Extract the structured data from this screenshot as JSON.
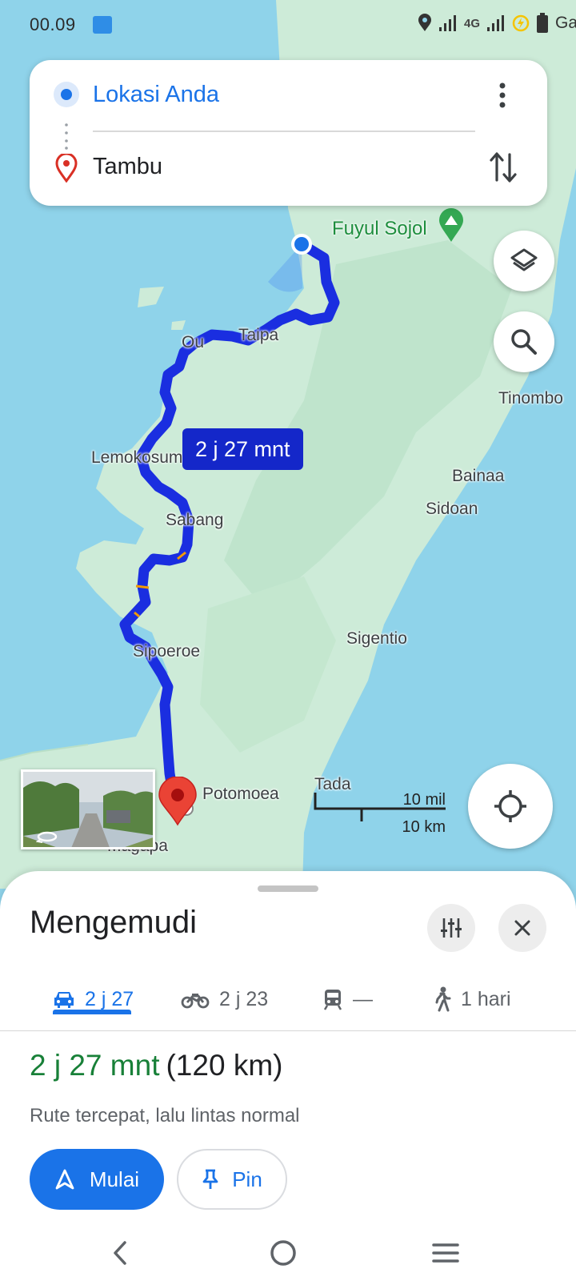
{
  "status_bar": {
    "time": "00.09",
    "network": "4G",
    "carrier": "Ga"
  },
  "directions": {
    "origin": "Lokasi Anda",
    "destination": "Tambu"
  },
  "map": {
    "poi": "Fuyul Sojol",
    "duration_callout": "2 j 27 mnt",
    "places": {
      "taipa": "Taipa",
      "ou": "Ou",
      "tinombo": "Tinombo",
      "lemokosumba": "Lemokosumba",
      "bainaa": "Bainaa",
      "sidoan": "Sidoan",
      "sabang": "Sabang",
      "sipoeroe": "Sipoeroe",
      "sigentio": "Sigentio",
      "tada": "Tada",
      "potomoea": "Potomoea",
      "magapa": "Magapa"
    },
    "scale": {
      "miles": "10 mil",
      "km": "10 km"
    }
  },
  "sheet": {
    "title": "Mengemudi",
    "tabs": [
      {
        "icon": "car-icon",
        "label": "2 j 27",
        "active": true
      },
      {
        "icon": "motorcycle-icon",
        "label": "2 j 23",
        "active": false
      },
      {
        "icon": "transit-icon",
        "label": "—",
        "active": false
      },
      {
        "icon": "walk-icon",
        "label": "1 hari",
        "active": false
      }
    ],
    "route_time": "2 j 27 mnt",
    "route_distance": "(120 km)",
    "route_note": "Rute tercepat, lalu lintas normal",
    "start_label": "Mulai",
    "pin_label": "Pin"
  },
  "colors": {
    "accent": "#1a73e8",
    "route": "#1a2ee0",
    "callout": "#1427c9",
    "duration_green": "#188038",
    "water": "#8fd3ea",
    "land": "#cdebd8"
  }
}
